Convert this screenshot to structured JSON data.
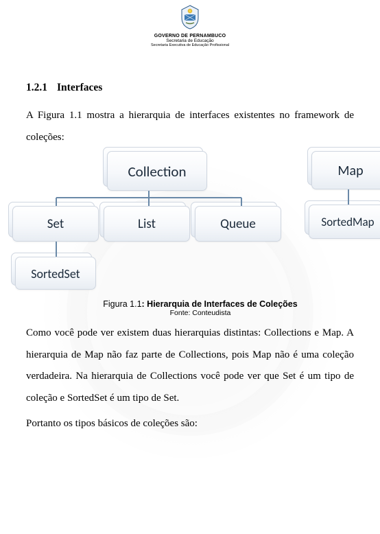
{
  "header": {
    "line1": "GOVERNO DE PERNAMBUCO",
    "line2": "Secretaria de Educação",
    "line3": "Secretaria Executiva de Educação Profissional"
  },
  "section": {
    "number": "1.2.1",
    "title": "Interfaces"
  },
  "intro": "A Figura 1.1 mostra a hierarquia de interfaces existentes no framework de coleções:",
  "chart_data": {
    "type": "diagram",
    "title": "Hierarquia de Interfaces de Coleções",
    "trees": [
      {
        "root": "Collection",
        "children": [
          {
            "name": "Set",
            "children": [
              {
                "name": "SortedSet"
              }
            ]
          },
          {
            "name": "List"
          },
          {
            "name": "Queue"
          }
        ]
      },
      {
        "root": "Map",
        "children": [
          {
            "name": "SortedMap"
          }
        ]
      }
    ]
  },
  "caption": {
    "label": "Figura 1.1",
    "title_bold": ": Hierarquia de Interfaces de Coleções",
    "source": "Fonte: Conteudista"
  },
  "para2": "Como você pode ver existem duas hierarquias distintas: Collections e Map. A hierarquia de Map não faz parte de Collections, pois Map não é uma coleção verdadeira. Na hierarquia de Collections você pode ver que Set é um tipo de coleção e SortedSet é um tipo de Set.",
  "para3": "Portanto os tipos básicos de coleções são:"
}
